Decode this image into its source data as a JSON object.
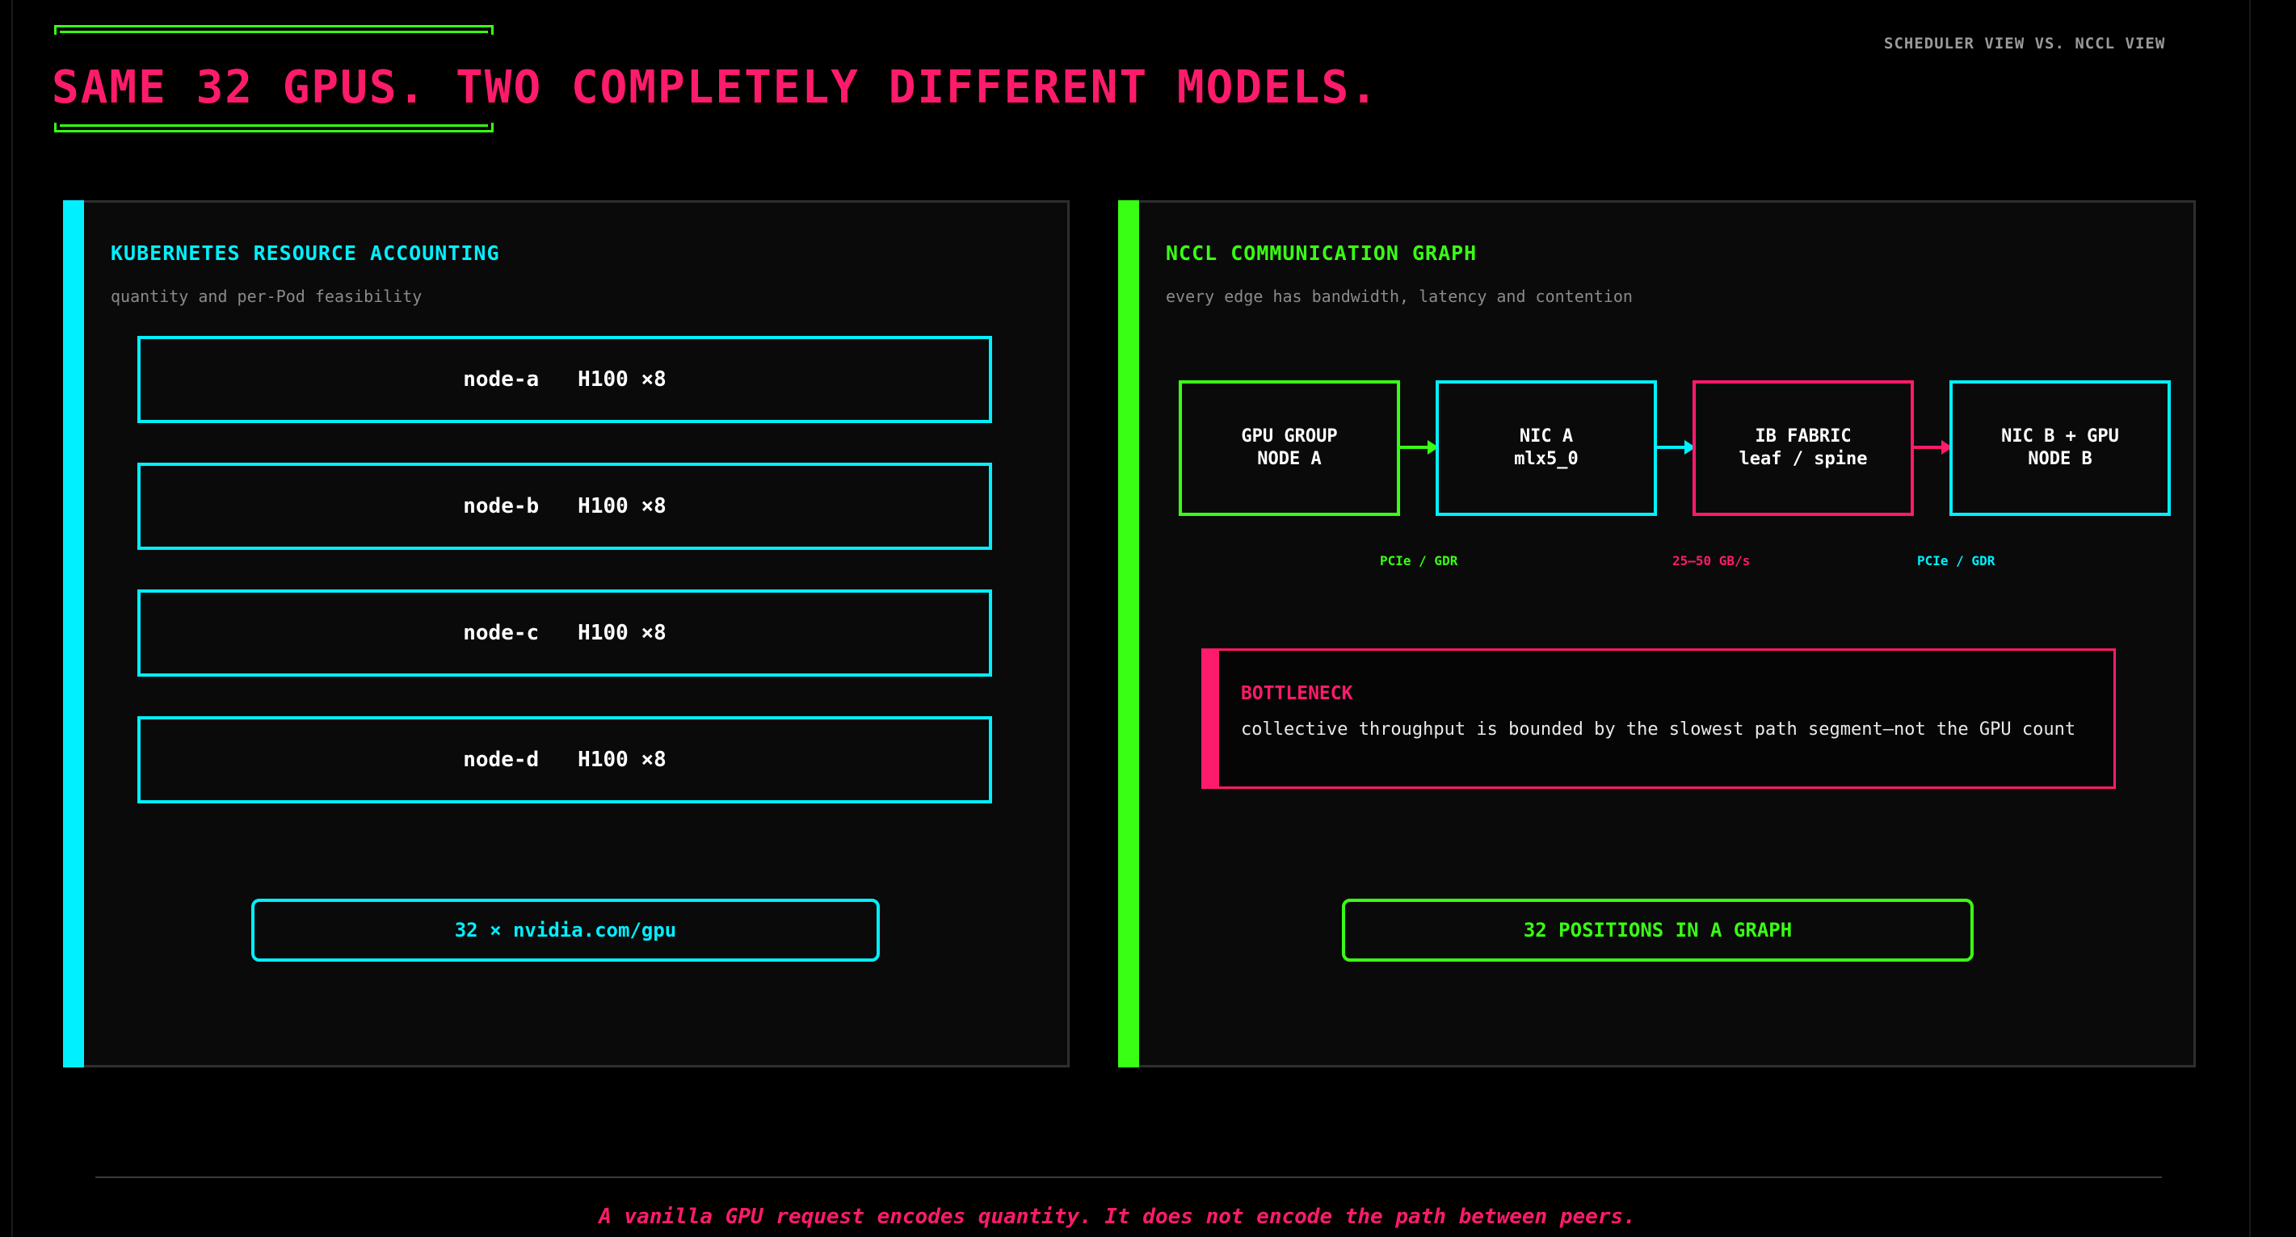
{
  "header": {
    "title": "SAME 32 GPUS. TWO COMPLETELY DIFFERENT MODELS.",
    "top_right_label": "SCHEDULER VIEW VS. NCCL VIEW"
  },
  "left_panel": {
    "title": "KUBERNETES RESOURCE ACCOUNTING",
    "subtitle": "quantity and per-Pod feasibility",
    "nodes": [
      {
        "name": "node-a",
        "gpus": "H100 ×8"
      },
      {
        "name": "node-b",
        "gpus": "H100 ×8"
      },
      {
        "name": "node-c",
        "gpus": "H100 ×8"
      },
      {
        "name": "node-d",
        "gpus": "H100 ×8"
      }
    ],
    "summary": "32 × nvidia.com/gpu"
  },
  "right_panel": {
    "title": "NCCL COMMUNICATION GRAPH",
    "subtitle": "every edge has bandwidth, latency and contention",
    "path": [
      {
        "line1": "GPU GROUP",
        "line2": "NODE A"
      },
      {
        "line1": "NIC A",
        "line2": "mlx5_0"
      },
      {
        "line1": "IB FABRIC",
        "line2": "leaf / spine"
      },
      {
        "line1": "NIC B + GPU",
        "line2": "NODE B"
      }
    ],
    "link_labels": [
      "PCIe / GDR",
      "25–50 GB/s",
      "PCIe / GDR"
    ],
    "bottleneck": {
      "title": "BOTTLENECK",
      "text": "collective throughput is bounded by the slowest path segment—not the GPU count"
    },
    "summary": "32 POSITIONS IN A GRAPH"
  },
  "footer": {
    "note": "A vanilla GPU request encodes quantity. It does not encode the path between peers."
  },
  "colors": {
    "background": "#000000",
    "pink": "#ff1b6b",
    "cyan": "#00f0ff",
    "green": "#39ff14"
  }
}
